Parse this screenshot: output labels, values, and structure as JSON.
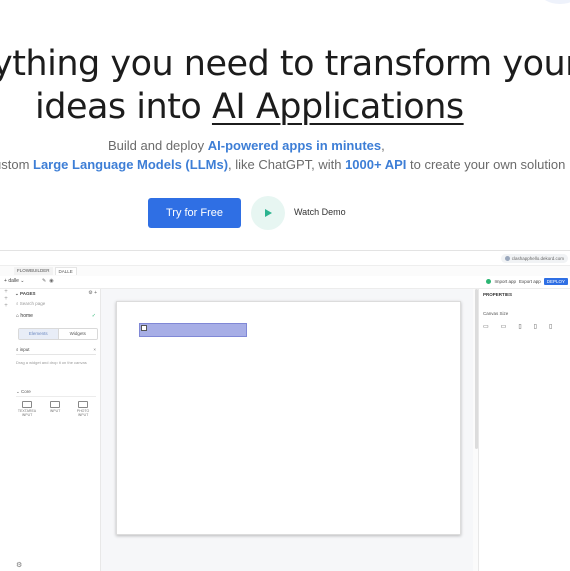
{
  "hero": {
    "title_line1": "ything you need to transform your",
    "title_line2_prefix": "ideas into ",
    "title_line2_highlight": "AI Applications",
    "sub1_part1": "Build and deploy ",
    "sub1_bold": "AI-powered apps in minutes",
    "sub1_part2": ",",
    "sub2_part1": "ustom ",
    "sub2_bold1": "Large Language Models (LLMs)",
    "sub2_part2": ", like ChatGPT, with ",
    "sub2_bold2": "1000+ API",
    "sub2_part3": " to create your own solution",
    "cta_label": "Try for Free",
    "watch_label": "Watch Demo"
  },
  "app": {
    "url": "clashapphello.dekord.com",
    "tabs": [
      {
        "label": "FLOWBUILDER"
      },
      {
        "label": "DALLE"
      }
    ],
    "project_name": "dalle",
    "import_label": "Import app",
    "export_label": "Export app",
    "deploy_label": "DEPLOY",
    "sidebar": {
      "pages_label": "PAGES",
      "search_placeholder": "Search page",
      "home_label": "home",
      "seg_left": "Elements",
      "seg_right": "Widgets",
      "input_value": "input",
      "hint": "Drag a widget and drop it on the canvas",
      "core_label": "Core",
      "widgets": [
        {
          "label": "TEXTAREA INPUT"
        },
        {
          "label": "INPUT"
        },
        {
          "label": "PHOTO INPUT"
        }
      ]
    },
    "properties": {
      "title": "PROPERTIES",
      "canvas_size_label": "Canvas Size"
    }
  },
  "colors": {
    "accent": "#2f6fe4",
    "highlight_text": "#3d7ed6",
    "play_bg": "#e7f6f2",
    "play_icon": "#2bb38f"
  }
}
